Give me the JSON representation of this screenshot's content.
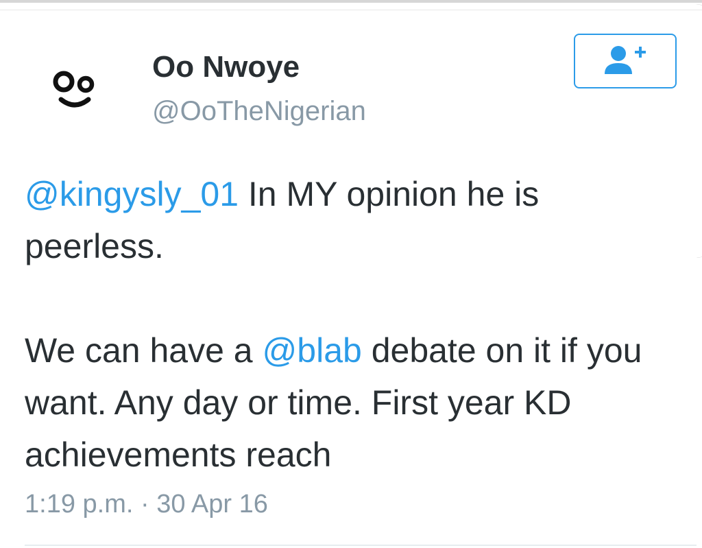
{
  "tweet": {
    "display_name": "Oo Nwoye",
    "handle": "@OoTheNigerian",
    "avatar": {
      "icon": "smiley-oo-logo-icon"
    },
    "follow_button": {
      "icon": "follow-user-plus-icon",
      "color": "#2b9be8"
    },
    "text": {
      "line1_mention": "@kingysly_01",
      "line1_rest": " In MY opinion he is peerless.",
      "para2_before": "We can have a ",
      "para2_mention": "@blab",
      "para2_after": " debate on it if you want. Any day or time. First year KD achievements reach"
    },
    "timestamp": "1:19 p.m. · 30 Apr 16"
  },
  "colors": {
    "link": "#2b9be8",
    "text": "#292f33",
    "muted": "#8899a6"
  }
}
